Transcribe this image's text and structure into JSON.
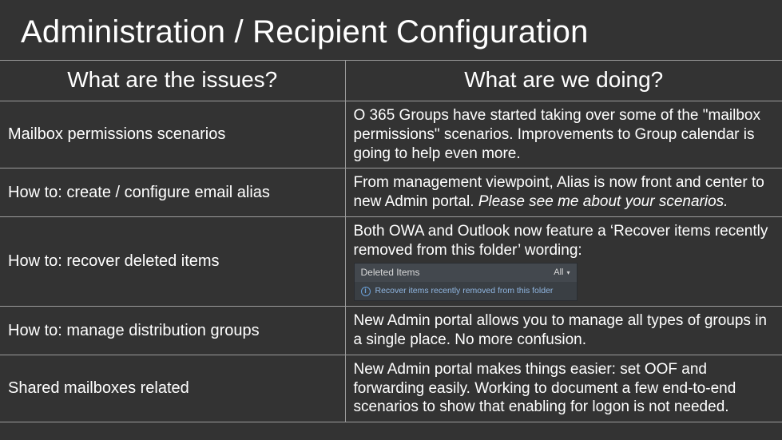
{
  "title": "Administration / Recipient Configuration",
  "headers": {
    "issues": "What are the issues?",
    "doing": "What are we doing?"
  },
  "rows": [
    {
      "issue": "Mailbox permissions scenarios",
      "doing": "O 365 Groups have started taking over some of the \"mailbox permissions\" scenarios. Improvements to Group calendar is going to help even more."
    },
    {
      "issue": "How to: create / configure email alias",
      "doing_pre": "From management viewpoint, Alias is now front and center to new Admin portal. ",
      "doing_italic": "Please see me about your scenarios."
    },
    {
      "issue": "How to: recover deleted items",
      "doing": "Both OWA and Outlook now feature a ‘Recover items recently removed from this folder’ wording:",
      "snippet": {
        "header": "Deleted Items",
        "filter": "All",
        "link": "Recover items recently removed from this folder"
      }
    },
    {
      "issue": "How to: manage distribution groups",
      "doing": "New Admin portal allows you to manage all types of groups in a single place. No more confusion."
    },
    {
      "issue": "Shared mailboxes related",
      "doing": "New Admin portal makes things easier: set OOF and forwarding easily. Working to document a few end-to-end scenarios to show that enabling for logon is not needed."
    }
  ]
}
